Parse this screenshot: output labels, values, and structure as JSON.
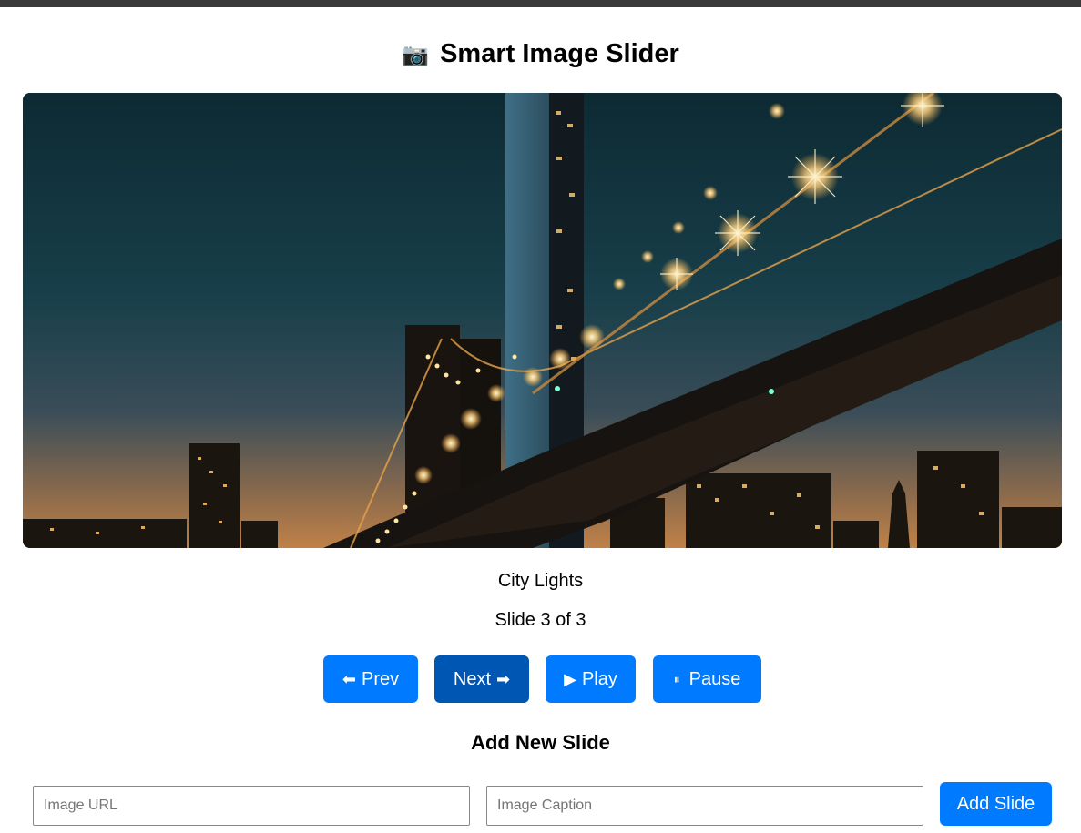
{
  "app": {
    "title_icon": "📷",
    "title": "Smart Image Slider"
  },
  "slide": {
    "image_description_icon": "city-bridge-night-image",
    "caption": "City Lights",
    "counter": "Slide 3 of 3"
  },
  "controls": {
    "prev_icon": "⬅",
    "prev_label": "Prev",
    "next_label": "Next",
    "next_icon": "➡",
    "play_icon": "▶",
    "play_label": "Play",
    "pause_icon": "⏸",
    "pause_label": "Pause"
  },
  "add_form": {
    "heading": "Add New Slide",
    "url_placeholder": "Image URL",
    "url_value": "",
    "caption_placeholder": "Image Caption",
    "caption_value": "",
    "submit_label": "Add Slide"
  },
  "colors": {
    "primary": "#007bff",
    "primary_active": "#0056b3",
    "top_bar": "#3a3a3a"
  }
}
